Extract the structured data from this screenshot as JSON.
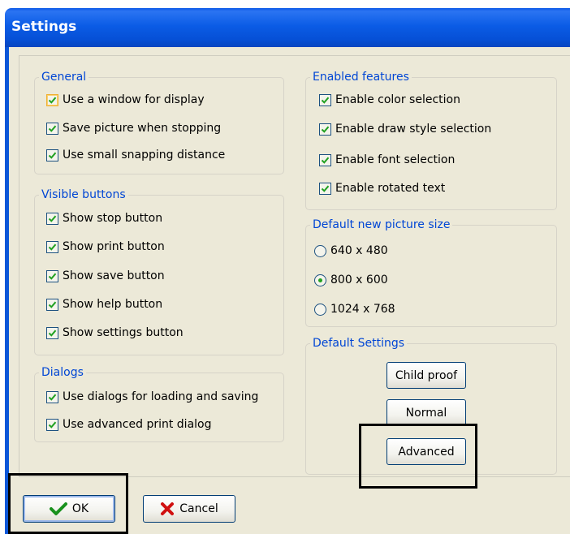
{
  "window": {
    "title": "Settings"
  },
  "general": {
    "legend": "General",
    "items": [
      {
        "label": "Use a window for display",
        "checked": true
      },
      {
        "label": "Save picture when stopping",
        "checked": true
      },
      {
        "label": "Use small snapping distance",
        "checked": true
      }
    ]
  },
  "visible_buttons": {
    "legend": "Visible buttons",
    "items": [
      {
        "label": "Show stop button",
        "checked": true
      },
      {
        "label": "Show print button",
        "checked": true
      },
      {
        "label": "Show save button",
        "checked": true
      },
      {
        "label": "Show help button",
        "checked": true
      },
      {
        "label": "Show settings button",
        "checked": true
      }
    ]
  },
  "dialogs": {
    "legend": "Dialogs",
    "items": [
      {
        "label": "Use dialogs for loading and saving",
        "checked": true
      },
      {
        "label": "Use advanced print dialog",
        "checked": true
      }
    ]
  },
  "enabled_features": {
    "legend": "Enabled features",
    "items": [
      {
        "label": "Enable color selection",
        "checked": true
      },
      {
        "label": "Enable draw style selection",
        "checked": true
      },
      {
        "label": "Enable font selection",
        "checked": true
      },
      {
        "label": "Enable rotated text",
        "checked": true
      }
    ]
  },
  "picture_size": {
    "legend": "Default new picture size",
    "options": [
      "640 x 480",
      "800 x 600",
      "1024 x 768"
    ],
    "selected": "800 x 600"
  },
  "default_settings": {
    "legend": "Default Settings",
    "child_proof": "Child proof",
    "normal": "Normal",
    "advanced": "Advanced"
  },
  "footer": {
    "ok": "OK",
    "cancel": "Cancel"
  },
  "colors": {
    "title_bar": "#0a58e8",
    "legend_text": "#0046d5",
    "check": "#21a121",
    "cancel_x": "#d01010"
  },
  "icons": {
    "ok": "checkmark-icon",
    "cancel": "cross-icon"
  }
}
